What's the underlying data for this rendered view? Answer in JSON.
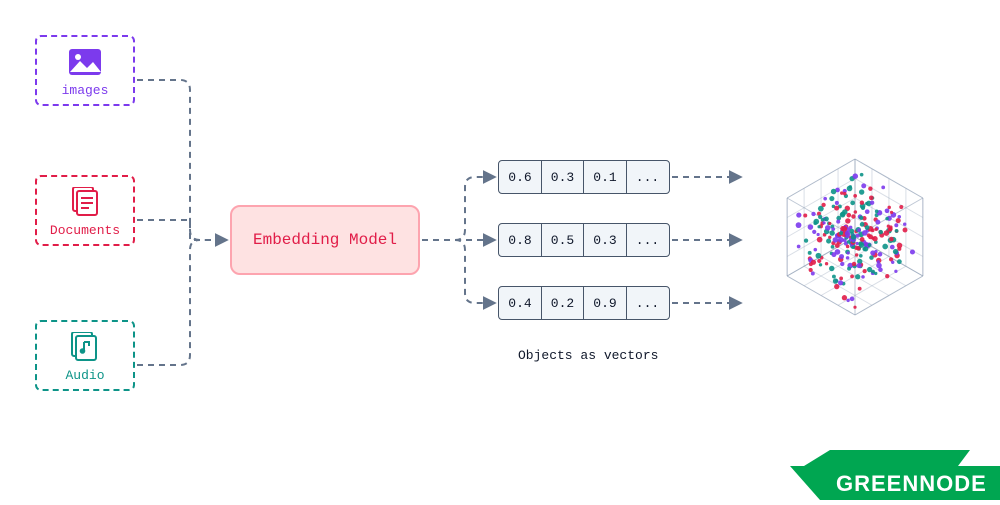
{
  "inputs": {
    "images": {
      "label": "images",
      "color": "#7c3aed",
      "icon": "image-icon"
    },
    "documents": {
      "label": "Documents",
      "color": "#e11d48",
      "icon": "document-stack-icon"
    },
    "audio": {
      "label": "Audio",
      "color": "#0d9488",
      "icon": "music-file-icon"
    }
  },
  "model": {
    "label": "Embedding Model"
  },
  "vectors": [
    {
      "cells": [
        "0.6",
        "0.3",
        "0.1",
        "..."
      ]
    },
    {
      "cells": [
        "0.8",
        "0.5",
        "0.3",
        "..."
      ]
    },
    {
      "cells": [
        "0.4",
        "0.2",
        "0.9",
        "..."
      ]
    }
  ],
  "vectors_caption": "Objects as vectors",
  "scatter": {
    "colors": [
      "#e11d48",
      "#0d9488",
      "#7c3aed"
    ],
    "note": "3D vector space with colored data points"
  },
  "brand": {
    "name": "GREENNODE",
    "color": "#00a651"
  },
  "arrow_color": "#64748b"
}
